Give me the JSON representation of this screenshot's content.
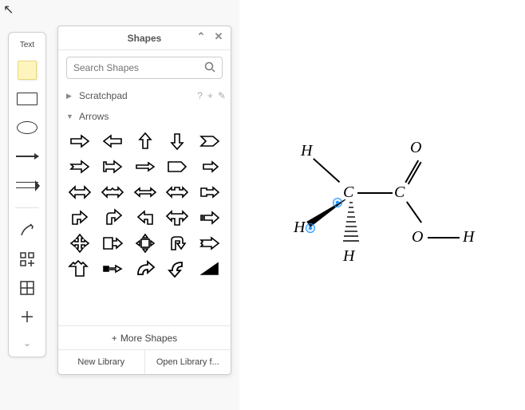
{
  "cursor": "↖",
  "mini_toolbar": {
    "text_label": "Text",
    "expand_label": "⌄"
  },
  "panel": {
    "title": "Shapes",
    "collapse_glyph": "⌃",
    "close_glyph": "✕",
    "search_placeholder": "Search Shapes",
    "search_icon": "🔍",
    "scratchpad": {
      "label": "Scratchpad",
      "actions": {
        "help": "?",
        "add": "+",
        "edit": "✎"
      }
    },
    "arrows_label": "Arrows",
    "more_shapes": "More Shapes",
    "plus_glyph": "+",
    "footer": {
      "new_library": "New Library",
      "open_library": "Open Library f..."
    }
  },
  "molecule": {
    "atoms": {
      "h_top": "H",
      "h_left": "H",
      "h_bottom": "H",
      "c_center": "C",
      "c_right": "C",
      "o_double": "O",
      "o_single": "O",
      "h_hydroxyl": "H"
    }
  }
}
